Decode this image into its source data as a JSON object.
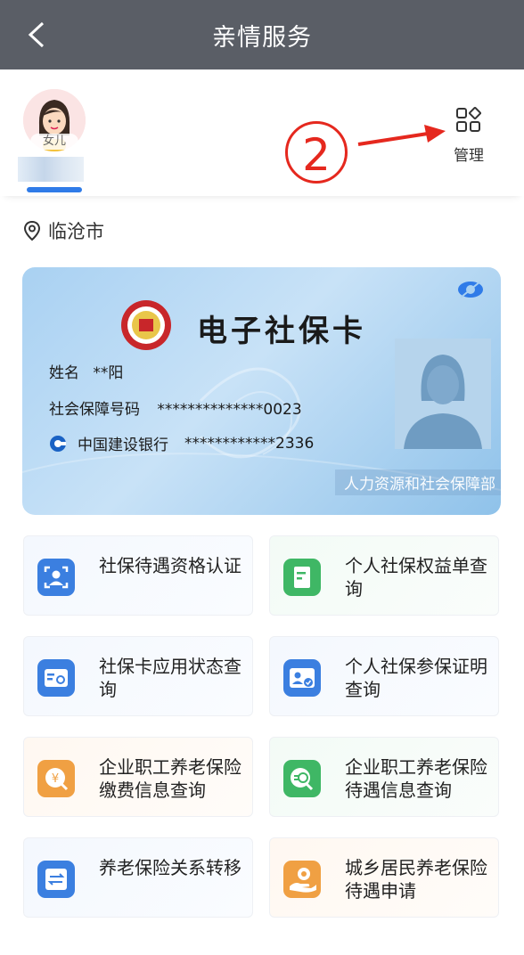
{
  "header": {
    "title": "亲情服务"
  },
  "family": {
    "member_tag": "女儿",
    "manage_label": "管理",
    "annotation_number": "2"
  },
  "location": {
    "city": "临沧市"
  },
  "card": {
    "title": "电子社保卡",
    "name_label": "姓名",
    "name_value": "**阳",
    "id_label": "社会保障号码",
    "id_value": "**************0023",
    "bank_label": "中国建设银行",
    "bank_value": "************2336",
    "issuer": "人力资源和社会保障部"
  },
  "services": [
    {
      "label": "社保待遇资格认证",
      "icon": "face-scan-icon",
      "color": "#3b7fe0"
    },
    {
      "label": "个人社保权益单查询",
      "icon": "document-icon",
      "color": "#3fb765"
    },
    {
      "label": "社保卡应用状态查询",
      "icon": "card-status-icon",
      "color": "#3b7fe0"
    },
    {
      "label": "个人社保参保证明查询",
      "icon": "id-card-icon",
      "color": "#3b7fe0"
    },
    {
      "label": "企业职工养老保险缴费信息查询",
      "icon": "payment-icon",
      "color": "#f0a043"
    },
    {
      "label": "企业职工养老保险待遇信息查询",
      "icon": "benefit-search-icon",
      "color": "#3fb765"
    },
    {
      "label": "养老保险关系转移",
      "icon": "transfer-icon",
      "color": "#3b7fe0"
    },
    {
      "label": "城乡居民养老保险待遇申请",
      "icon": "hand-coin-icon",
      "color": "#f0a043"
    }
  ]
}
